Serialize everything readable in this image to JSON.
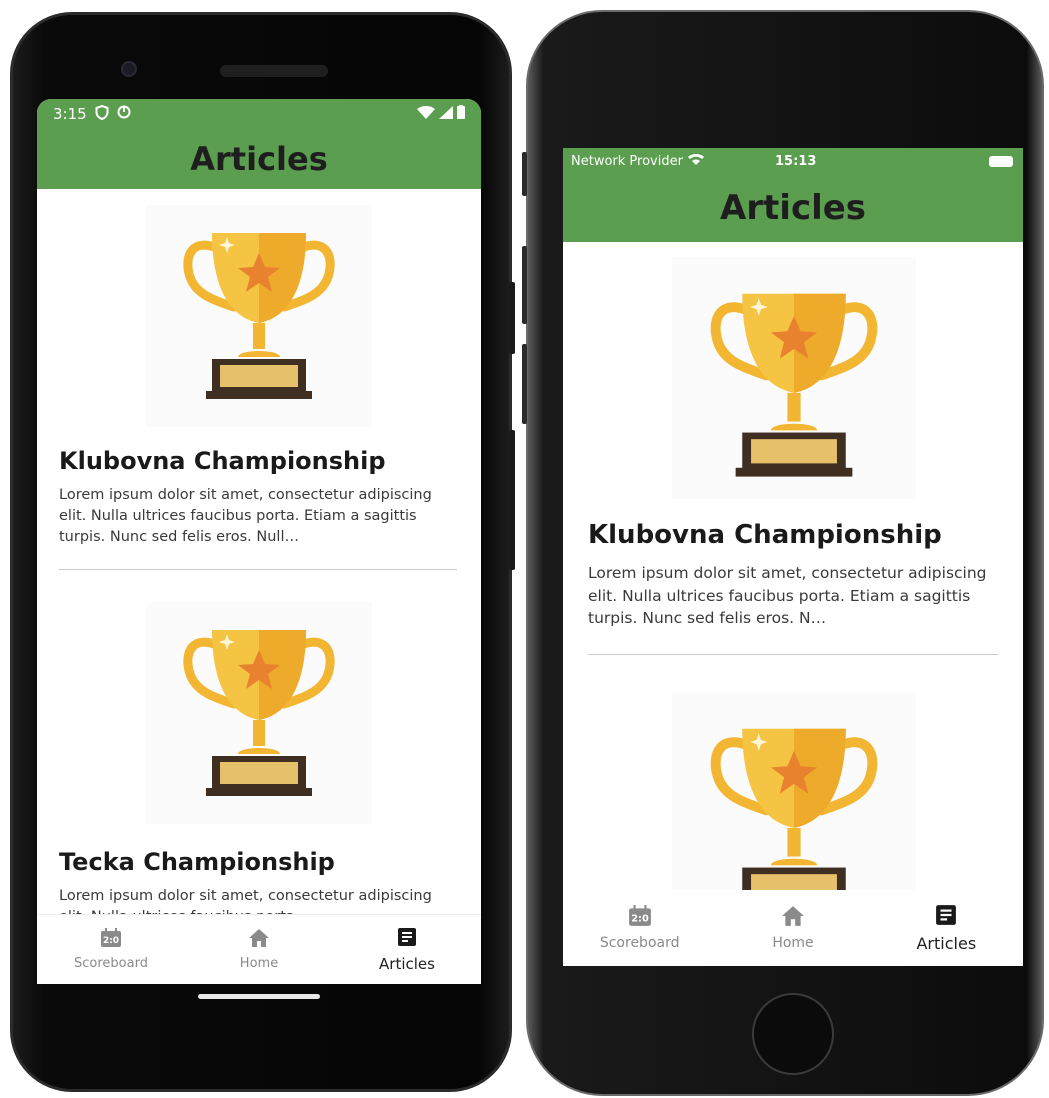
{
  "theme": {
    "header_bg": "#5c9e4f",
    "trophy_gold": "#f2b632",
    "trophy_base": "#3f2e22",
    "nav_active": "#222222",
    "nav_inactive": "#8a8a8a"
  },
  "android": {
    "status": {
      "time": "3:15"
    },
    "header": {
      "title": "Articles"
    },
    "articles": [
      {
        "title": "Klubovna Championship",
        "body": "Lorem ipsum dolor sit amet, consectetur adipiscing elit. Nulla ultrices faucibus porta. Etiam a sagittis turpis. Nunc sed felis eros. Null…",
        "image": "trophy-image"
      },
      {
        "title": "Tecka Championship",
        "body": "Lorem ipsum dolor sit amet, consectetur adipiscing elit. Nulla ultrices faucibus porta.",
        "image": "trophy-image"
      }
    ],
    "nav": [
      {
        "label": "Scoreboard",
        "icon": "scoreboard-icon",
        "active": false
      },
      {
        "label": "Home",
        "icon": "home-icon",
        "active": false
      },
      {
        "label": "Articles",
        "icon": "articles-icon",
        "active": true
      }
    ]
  },
  "ios": {
    "status": {
      "carrier": "Network Provider",
      "time": "15:13"
    },
    "header": {
      "title": "Articles"
    },
    "articles": [
      {
        "title": "Klubovna Championship",
        "body": "Lorem ipsum dolor sit amet, consectetur adipiscing elit. Nulla ultrices faucibus porta. Etiam a sagittis turpis. Nunc sed felis eros. N…",
        "image": "trophy-image"
      },
      {
        "title": "",
        "body": "",
        "image": "trophy-image"
      }
    ],
    "nav": [
      {
        "label": "Scoreboard",
        "icon": "scoreboard-icon",
        "active": false
      },
      {
        "label": "Home",
        "icon": "home-icon",
        "active": false
      },
      {
        "label": "Articles",
        "icon": "articles-icon",
        "active": true
      }
    ]
  }
}
